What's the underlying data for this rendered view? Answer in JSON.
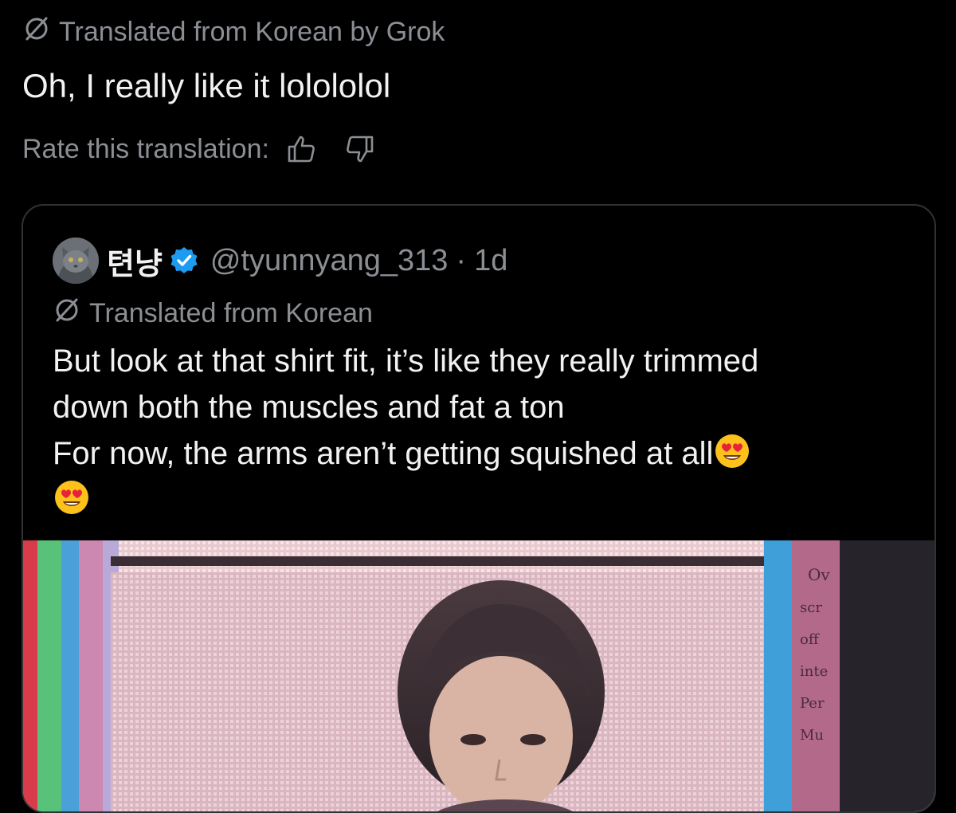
{
  "top_post": {
    "translation_label": "Translated from Korean by Grok",
    "translated_text": "Oh, I really like it lolololol",
    "rate_label": "Rate this translation:"
  },
  "quote": {
    "display_name": "텬냥",
    "handle": "@tyunnyang_313",
    "separator": "·",
    "time": "1d",
    "translation_label": "Translated from Korean",
    "lines": [
      "But look at that shirt fit, it’s like they really trimmed",
      "down both the muscles and fat a ton",
      "For now, the arms aren’t getting squished at all"
    ],
    "icons": {
      "verified": "verified-badge-icon",
      "emoji": "heart-eyes-emoji-icon"
    }
  },
  "colors": {
    "background": "#000000",
    "text_primary": "#f2f2f2",
    "text_secondary": "#8b8f94",
    "verified_blue": "#1d9bf0",
    "card_border": "#2f3336"
  }
}
